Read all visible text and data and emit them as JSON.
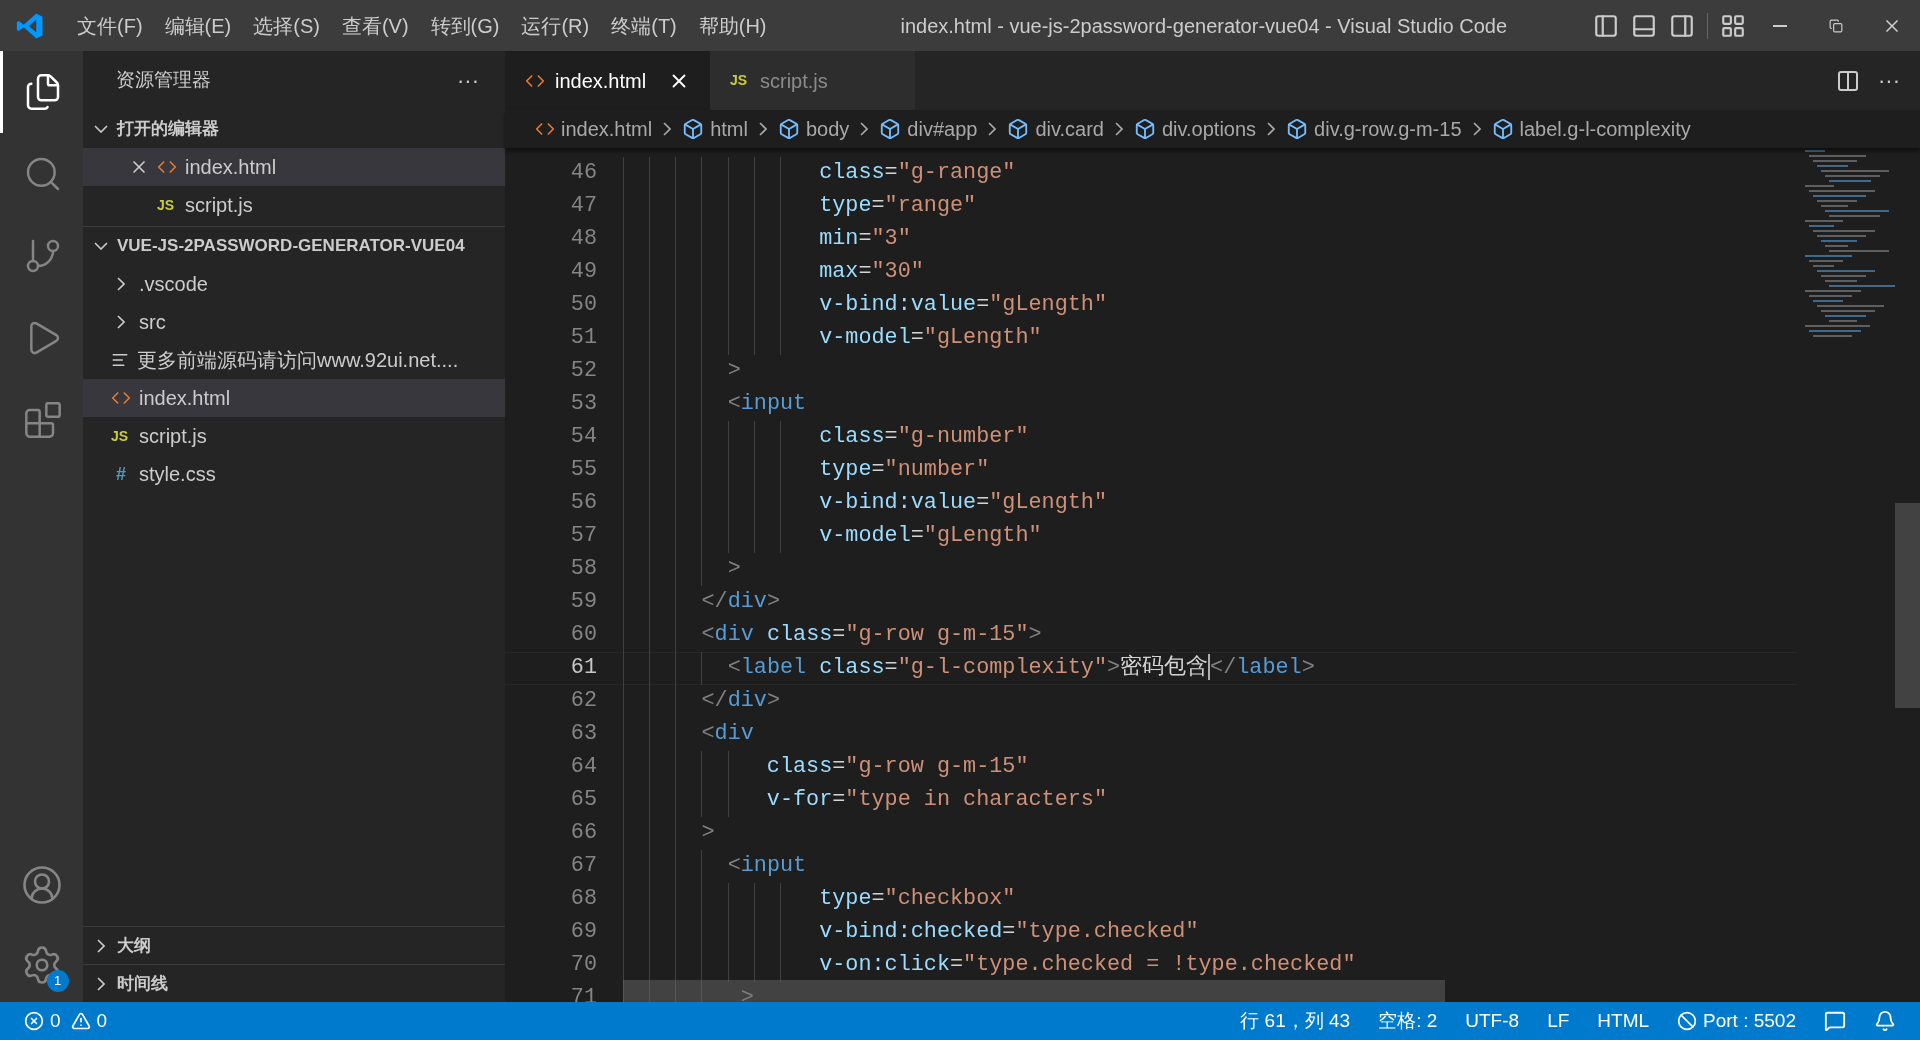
{
  "menu": [
    "文件(F)",
    "编辑(E)",
    "选择(S)",
    "查看(V)",
    "转到(G)",
    "运行(R)",
    "终端(T)",
    "帮助(H)"
  ],
  "window": {
    "title": "index.html - vue-js-2password-generator-vue04 - Visual Studio Code"
  },
  "activity_bar": [
    {
      "kind": "explorer",
      "selected": true
    },
    {
      "kind": "search",
      "selected": false
    },
    {
      "kind": "scm",
      "selected": false
    },
    {
      "kind": "debug",
      "selected": false
    },
    {
      "kind": "extensions",
      "selected": false
    }
  ],
  "settings_badge": "1",
  "sidebar": {
    "title": "资源管理器",
    "more": "···",
    "sections": [
      {
        "title": "打开的编辑器",
        "expanded": true,
        "items": [
          {
            "kind": "html",
            "label": "index.html",
            "selected": true
          },
          {
            "kind": "js",
            "badge": "JS",
            "label": "script.js",
            "selected": false
          }
        ]
      },
      {
        "title": "VUE-JS-2PASSWORD-GENERATOR-VUE04",
        "expanded": true,
        "items": [
          {
            "kind": "folder",
            "label": ".vscode",
            "expanded": false,
            "selected": false
          },
          {
            "kind": "folder",
            "label": "src",
            "expanded": false,
            "selected": false
          },
          {
            "kind": "text",
            "label": "更多前端源码请访问www.92ui.net....",
            "selected": false
          },
          {
            "kind": "html",
            "label": "index.html",
            "selected": true
          },
          {
            "kind": "js",
            "badge": "JS",
            "label": "script.js",
            "selected": false
          },
          {
            "kind": "css",
            "badge": "#",
            "label": "style.css",
            "selected": false
          }
        ]
      }
    ],
    "bottom_sections": [
      {
        "title": "大纲",
        "expanded": false
      },
      {
        "title": "时间线",
        "expanded": false
      }
    ]
  },
  "tabs": [
    {
      "kind": "html",
      "label": "index.html",
      "selected": true
    },
    {
      "kind": "js",
      "badge": "JS",
      "label": "script.js",
      "selected": false
    }
  ],
  "tab_more": "···",
  "breadcrumbs": [
    {
      "kind": "file",
      "label": "index.html"
    },
    {
      "kind": "element",
      "label": "html"
    },
    {
      "kind": "element",
      "label": "body"
    },
    {
      "kind": "element",
      "label": "div#app"
    },
    {
      "kind": "element",
      "label": "div.card"
    },
    {
      "kind": "element",
      "label": "div.options"
    },
    {
      "kind": "element",
      "label": "div.g-row.g-m-15"
    },
    {
      "kind": "element",
      "label": "label.g-l-complexity"
    }
  ],
  "editor": {
    "lines": [
      {
        "number": "46",
        "current": false,
        "tokens": [
          {
            "kind": "attr",
            "text": "               class"
          },
          {
            "kind": "plain",
            "text": "="
          },
          {
            "kind": "str",
            "text": "\"g-range\""
          }
        ]
      },
      {
        "number": "47",
        "current": false,
        "tokens": [
          {
            "kind": "attr",
            "text": "               type"
          },
          {
            "kind": "plain",
            "text": "="
          },
          {
            "kind": "str",
            "text": "\"range\""
          }
        ]
      },
      {
        "number": "48",
        "current": false,
        "tokens": [
          {
            "kind": "attr",
            "text": "               min"
          },
          {
            "kind": "plain",
            "text": "="
          },
          {
            "kind": "str",
            "text": "\"3\""
          }
        ]
      },
      {
        "number": "49",
        "current": false,
        "tokens": [
          {
            "kind": "attr",
            "text": "               max"
          },
          {
            "kind": "plain",
            "text": "="
          },
          {
            "kind": "str",
            "text": "\"30\""
          }
        ]
      },
      {
        "number": "50",
        "current": false,
        "tokens": [
          {
            "kind": "attr",
            "text": "               v-bind:value"
          },
          {
            "kind": "plain",
            "text": "="
          },
          {
            "kind": "str",
            "text": "\"gLength\""
          }
        ]
      },
      {
        "number": "51",
        "current": false,
        "tokens": [
          {
            "kind": "attr",
            "text": "               v-model"
          },
          {
            "kind": "plain",
            "text": "="
          },
          {
            "kind": "str",
            "text": "\"gLength\""
          }
        ]
      },
      {
        "number": "52",
        "current": false,
        "tokens": [
          {
            "kind": "punct",
            "text": "        >"
          }
        ]
      },
      {
        "number": "53",
        "current": false,
        "tokens": [
          {
            "kind": "punct",
            "text": "        <"
          },
          {
            "kind": "tag",
            "text": "input"
          }
        ]
      },
      {
        "number": "54",
        "current": false,
        "tokens": [
          {
            "kind": "attr",
            "text": "               class"
          },
          {
            "kind": "plain",
            "text": "="
          },
          {
            "kind": "str",
            "text": "\"g-number\""
          }
        ]
      },
      {
        "number": "55",
        "current": false,
        "tokens": [
          {
            "kind": "attr",
            "text": "               type"
          },
          {
            "kind": "plain",
            "text": "="
          },
          {
            "kind": "str",
            "text": "\"number\""
          }
        ]
      },
      {
        "number": "56",
        "current": false,
        "tokens": [
          {
            "kind": "attr",
            "text": "               v-bind:value"
          },
          {
            "kind": "plain",
            "text": "="
          },
          {
            "kind": "str",
            "text": "\"gLength\""
          }
        ]
      },
      {
        "number": "57",
        "current": false,
        "tokens": [
          {
            "kind": "attr",
            "text": "               v-model"
          },
          {
            "kind": "plain",
            "text": "="
          },
          {
            "kind": "str",
            "text": "\"gLength\""
          }
        ]
      },
      {
        "number": "58",
        "current": false,
        "tokens": [
          {
            "kind": "punct",
            "text": "        >"
          }
        ]
      },
      {
        "number": "59",
        "current": false,
        "tokens": [
          {
            "kind": "punct",
            "text": "      </"
          },
          {
            "kind": "tag",
            "text": "div"
          },
          {
            "kind": "punct",
            "text": ">"
          }
        ]
      },
      {
        "number": "60",
        "current": false,
        "tokens": [
          {
            "kind": "punct",
            "text": "      <"
          },
          {
            "kind": "tag",
            "text": "div "
          },
          {
            "kind": "attr",
            "text": "class"
          },
          {
            "kind": "plain",
            "text": "="
          },
          {
            "kind": "str",
            "text": "\"g-row g-m-15\""
          },
          {
            "kind": "punct",
            "text": ">"
          }
        ]
      },
      {
        "number": "61",
        "current": true,
        "tokens": [
          {
            "kind": "punct",
            "text": "        <"
          },
          {
            "kind": "tag",
            "text": "label "
          },
          {
            "kind": "attr",
            "text": "class"
          },
          {
            "kind": "plain",
            "text": "="
          },
          {
            "kind": "str",
            "text": "\"g-l-complexity\""
          },
          {
            "kind": "punct",
            "text": ">"
          },
          {
            "kind": "plain",
            "text": "密码包含"
          },
          {
            "kind": "cursor"
          },
          {
            "kind": "punct",
            "text": "</"
          },
          {
            "kind": "tag",
            "text": "label"
          },
          {
            "kind": "punct",
            "text": ">"
          }
        ]
      },
      {
        "number": "62",
        "current": false,
        "tokens": [
          {
            "kind": "punct",
            "text": "      </"
          },
          {
            "kind": "tag",
            "text": "div"
          },
          {
            "kind": "punct",
            "text": ">"
          }
        ]
      },
      {
        "number": "63",
        "current": false,
        "tokens": [
          {
            "kind": "punct",
            "text": "      <"
          },
          {
            "kind": "tag",
            "text": "div"
          }
        ]
      },
      {
        "number": "64",
        "current": false,
        "tokens": [
          {
            "kind": "attr",
            "text": "           class"
          },
          {
            "kind": "plain",
            "text": "="
          },
          {
            "kind": "str",
            "text": "\"g-row g-m-15\""
          }
        ]
      },
      {
        "number": "65",
        "current": false,
        "tokens": [
          {
            "kind": "attr",
            "text": "           v-for"
          },
          {
            "kind": "plain",
            "text": "="
          },
          {
            "kind": "str",
            "text": "\"type in characters\""
          }
        ]
      },
      {
        "number": "66",
        "current": false,
        "tokens": [
          {
            "kind": "punct",
            "text": "      >"
          }
        ]
      },
      {
        "number": "67",
        "current": false,
        "tokens": [
          {
            "kind": "punct",
            "text": "        <"
          },
          {
            "kind": "tag",
            "text": "input"
          }
        ]
      },
      {
        "number": "68",
        "current": false,
        "tokens": [
          {
            "kind": "attr",
            "text": "               type"
          },
          {
            "kind": "plain",
            "text": "="
          },
          {
            "kind": "str",
            "text": "\"checkbox\""
          }
        ]
      },
      {
        "number": "69",
        "current": false,
        "tokens": [
          {
            "kind": "attr",
            "text": "               v-bind:checked"
          },
          {
            "kind": "plain",
            "text": "="
          },
          {
            "kind": "str",
            "text": "\"type.checked\""
          }
        ]
      },
      {
        "number": "70",
        "current": false,
        "tokens": [
          {
            "kind": "attr",
            "text": "               v-on:click"
          },
          {
            "kind": "plain",
            "text": "="
          },
          {
            "kind": "str",
            "text": "\"type.checked = !type.checked\""
          }
        ]
      },
      {
        "number": "71",
        "current": false,
        "tokens": [
          {
            "kind": "punct",
            "text": "         >"
          }
        ]
      }
    ]
  },
  "status_bar": {
    "errors": "0",
    "warnings": "0",
    "items": [
      {
        "kind": "text",
        "label": "行 61，列 43"
      },
      {
        "kind": "text",
        "label": "空格: 2"
      },
      {
        "kind": "text",
        "label": "UTF-8"
      },
      {
        "kind": "text",
        "label": "LF"
      },
      {
        "kind": "text",
        "label": "HTML"
      },
      {
        "kind": "port",
        "label": "Port : 5502"
      }
    ]
  }
}
